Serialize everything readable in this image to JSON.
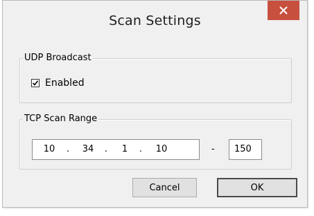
{
  "window": {
    "title": "Scan Settings",
    "close_icon": "close-icon",
    "accent_close": "#c7503e"
  },
  "udp": {
    "legend": "UDP Broadcast",
    "enabled_label": "Enabled",
    "enabled_checked": true
  },
  "tcp": {
    "legend": "TCP Scan Range",
    "ip": [
      "10",
      "34",
      "1",
      "10"
    ],
    "ip_separator": ".",
    "range_separator": "-",
    "range_end": "150"
  },
  "buttons": {
    "cancel_label": "Cancel",
    "ok_label": "OK"
  }
}
